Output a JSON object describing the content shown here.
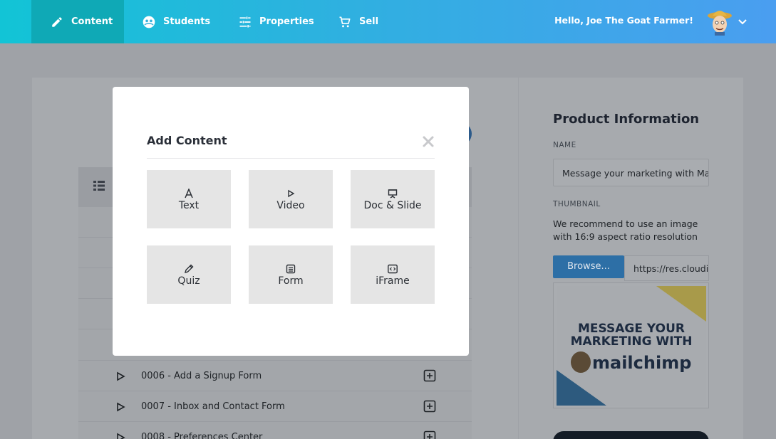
{
  "nav": {
    "items": [
      {
        "label": "Content",
        "icon": "pencil-icon"
      },
      {
        "label": "Students",
        "icon": "students-icon"
      },
      {
        "label": "Properties",
        "icon": "sliders-icon"
      },
      {
        "label": "Sell",
        "icon": "cart-icon"
      }
    ],
    "greeting": "Hello, Joe The Goat Farmer!"
  },
  "lessons": [
    {
      "title": "0006 - Add a Signup Form"
    },
    {
      "title": "0007 - Inbox and Contact Form"
    },
    {
      "title": "0008 - Preferences Center"
    }
  ],
  "product": {
    "title": "Product Information",
    "name_label": "NAME",
    "name_value": "Message your marketing with Mailchimp",
    "thumbnail_label": "THUMBNAIL",
    "thumbnail_note": "We recommend to use an image with 16:9 aspect ratio resolution",
    "browse_label": "Browse...",
    "url_value": "https://res.cloudinary.com",
    "thumb_line1": "MESSAGE YOUR",
    "thumb_line2": "MARKETING WITH",
    "thumb_brand": "mailchimp"
  },
  "modal": {
    "title": "Add Content",
    "options": [
      {
        "label": "Text",
        "icon": "text-icon"
      },
      {
        "label": "Video",
        "icon": "play-icon"
      },
      {
        "label": "Doc & Slide",
        "icon": "presentation-icon"
      },
      {
        "label": "Quiz",
        "icon": "pencil-icon"
      },
      {
        "label": "Form",
        "icon": "form-icon"
      },
      {
        "label": "iFrame",
        "icon": "code-icon"
      }
    ]
  },
  "colors": {
    "topbar_start": "#12c4d6",
    "topbar_end": "#4a9ef0",
    "active_nav": "#0fa9b6",
    "tile_bg": "#e5e5e5",
    "browse_button": "#2d6fa6"
  }
}
